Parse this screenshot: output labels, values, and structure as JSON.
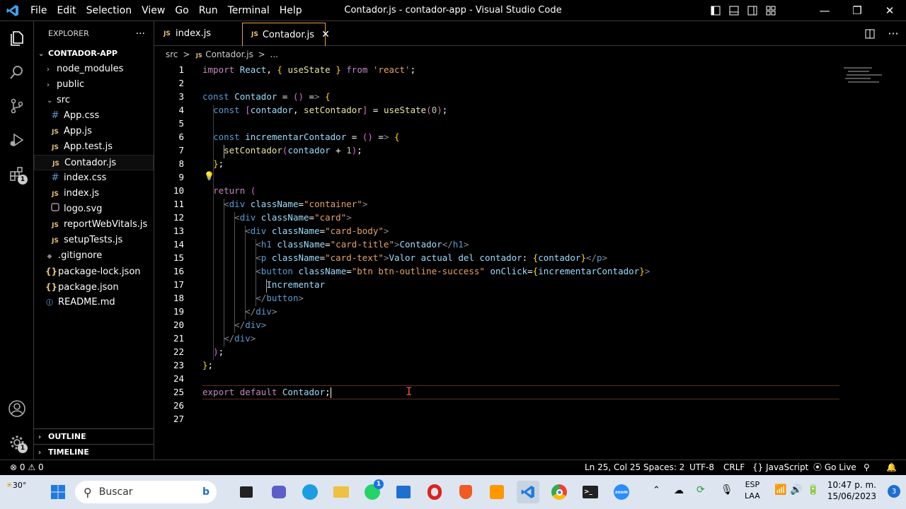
{
  "window": {
    "title": "Contador.js - contador-app - Visual Studio Code",
    "menu": [
      "File",
      "Edit",
      "Selection",
      "View",
      "Go",
      "Run",
      "Terminal",
      "Help"
    ]
  },
  "activity_bar": {
    "extensions_badge": "1",
    "settings_badge": "1"
  },
  "sidebar": {
    "header": "EXPLORER",
    "project": "CONTADOR-APP",
    "items": [
      {
        "label": "node_modules",
        "kind": "folder-collapsed"
      },
      {
        "label": "public",
        "kind": "folder-collapsed"
      },
      {
        "label": "src",
        "kind": "folder-open"
      },
      {
        "label": "App.css",
        "kind": "css",
        "icon": "#"
      },
      {
        "label": "App.js",
        "kind": "js",
        "icon": "JS"
      },
      {
        "label": "App.test.js",
        "kind": "js",
        "icon": "JS"
      },
      {
        "label": "Contador.js",
        "kind": "js",
        "icon": "JS"
      },
      {
        "label": "index.css",
        "kind": "css",
        "icon": "#"
      },
      {
        "label": "index.js",
        "kind": "js",
        "icon": "JS"
      },
      {
        "label": "logo.svg",
        "kind": "svg"
      },
      {
        "label": "reportWebVitals.js",
        "kind": "js",
        "icon": "JS"
      },
      {
        "label": "setupTests.js",
        "kind": "js",
        "icon": "JS"
      },
      {
        "label": ".gitignore",
        "kind": "git"
      },
      {
        "label": "package-lock.json",
        "kind": "json",
        "icon": "{}"
      },
      {
        "label": "package.json",
        "kind": "json",
        "icon": "{}"
      },
      {
        "label": "README.md",
        "kind": "md",
        "icon": "ⓘ"
      }
    ],
    "outline": "OUTLINE",
    "timeline": "TIMELINE"
  },
  "tabs": [
    {
      "label": "index.js",
      "icon": "JS",
      "active": false
    },
    {
      "label": "Contador.js",
      "icon": "JS",
      "active": true
    }
  ],
  "breadcrumb": {
    "folder": "src",
    "sep": ">",
    "file": "Contador.js",
    "more": "..."
  },
  "code_lines": [
    "import React, { useState } from 'react';",
    "",
    "const Contador = () => {",
    "  const [contador, setContador] = useState(0);",
    "",
    "  const incrementarContador = () => {",
    "    setContador(contador + 1);",
    "  };",
    "",
    "  return (",
    "    <div className=\"container\">",
    "      <div className=\"card\">",
    "        <div className=\"card-body\">",
    "          <h1 className=\"card-title\">Contador</h1>",
    "          <p className=\"card-text\">Valor actual del contador: {contador}</p>",
    "          <button className=\"btn btn-outline-success\" onClick={incrementarContador}>",
    "            Incrementar",
    "          </button>",
    "        </div>",
    "      </div>",
    "    </div>",
    "  );",
    "};",
    "",
    "export default Contador;",
    "",
    ""
  ],
  "status_bar": {
    "errors": "0",
    "warnings": "0",
    "position": "Ln 25, Col 25",
    "spaces": "Spaces: 2",
    "encoding": "UTF-8",
    "eol": "CRLF",
    "language": "JavaScript",
    "language_icon": "{}",
    "golive": "Go Live"
  },
  "taskbar": {
    "weather": "30°",
    "search_placeholder": "Buscar",
    "whatsapp_badge": "1",
    "lang_top": "ESP",
    "lang_bottom": "LAA",
    "time": "10:47 p. m.",
    "date": "15/06/2023",
    "notifications": "3"
  }
}
